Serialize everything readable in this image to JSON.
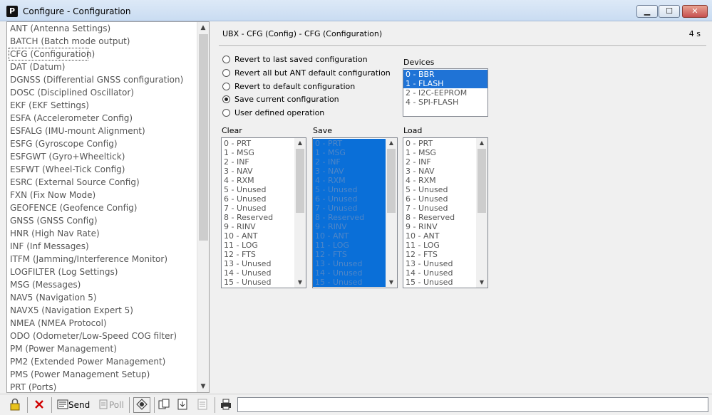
{
  "window": {
    "icon_letter": "P",
    "title": "Configure - Configuration"
  },
  "left_list": {
    "items": [
      "ANT (Antenna Settings)",
      "BATCH (Batch mode output)",
      "CFG (Configuration)",
      "DAT (Datum)",
      "DGNSS (Differential GNSS configuration)",
      "DOSC (Disciplined Oscillator)",
      "EKF (EKF Settings)",
      "ESFA (Accelerometer Config)",
      "ESFALG (IMU-mount Alignment)",
      "ESFG (Gyroscope Config)",
      "ESFGWT (Gyro+Wheeltick)",
      "ESFWT (Wheel-Tick Config)",
      "ESRC (External Source Config)",
      "FXN (Fix Now Mode)",
      "GEOFENCE (Geofence Config)",
      "GNSS (GNSS Config)",
      "HNR (High Nav Rate)",
      "INF (Inf Messages)",
      "ITFM (Jamming/Interference Monitor)",
      "LOGFILTER (Log Settings)",
      "MSG (Messages)",
      "NAV5 (Navigation 5)",
      "NAVX5 (Navigation Expert 5)",
      "NMEA (NMEA Protocol)",
      "ODO (Odometer/Low-Speed COG filter)",
      "PM (Power Management)",
      "PM2 (Extended Power Management)",
      "PMS (Power Management Setup)",
      "PRT (Ports)"
    ],
    "selected_index": 2
  },
  "header": {
    "title": "UBX - CFG (Config) - CFG (Configuration)",
    "time": "4 s"
  },
  "radio_options": [
    {
      "label": "Revert to last saved configuration",
      "checked": false
    },
    {
      "label": "Revert all but ANT default configuration",
      "checked": false
    },
    {
      "label": "Revert to default configuration",
      "checked": false
    },
    {
      "label": "Save current configuration",
      "checked": true
    },
    {
      "label": "User defined operation",
      "checked": false
    }
  ],
  "devices": {
    "label": "Devices",
    "items": [
      "0 - BBR",
      "1 - FLASH",
      "2 - I2C-EEPROM",
      "4 - SPI-FLASH"
    ],
    "selected": [
      0,
      1
    ]
  },
  "clear": {
    "label": "Clear",
    "items": [
      "0 - PRT",
      "1 - MSG",
      "2 - INF",
      "3 - NAV",
      "4 - RXM",
      "5 - Unused",
      "6 - Unused",
      "7 - Unused",
      "8 - Reserved",
      "9 - RINV",
      "10 - ANT",
      "11 - LOG",
      "12 - FTS",
      "13 - Unused",
      "14 - Unused",
      "15 - Unused"
    ]
  },
  "save": {
    "label": "Save",
    "items": [
      "0 - PRT",
      "1 - MSG",
      "2 - INF",
      "3 - NAV",
      "4 - RXM",
      "5 - Unused",
      "6 - Unused",
      "7 - Unused",
      "8 - Reserved",
      "9 - RINV",
      "10 - ANT",
      "11 - LOG",
      "12 - FTS",
      "13 - Unused",
      "14 - Unused",
      "15 - Unused"
    ]
  },
  "load": {
    "label": "Load",
    "items": [
      "0 - PRT",
      "1 - MSG",
      "2 - INF",
      "3 - NAV",
      "4 - RXM",
      "5 - Unused",
      "6 - Unused",
      "7 - Unused",
      "8 - Reserved",
      "9 - RINV",
      "10 - ANT",
      "11 - LOG",
      "12 - FTS",
      "13 - Unused",
      "14 - Unused",
      "15 - Unused"
    ]
  },
  "toolbar": {
    "send_label": "Send",
    "poll_label": "Poll"
  },
  "colors": {
    "selection_blue": "#1f73d6"
  }
}
